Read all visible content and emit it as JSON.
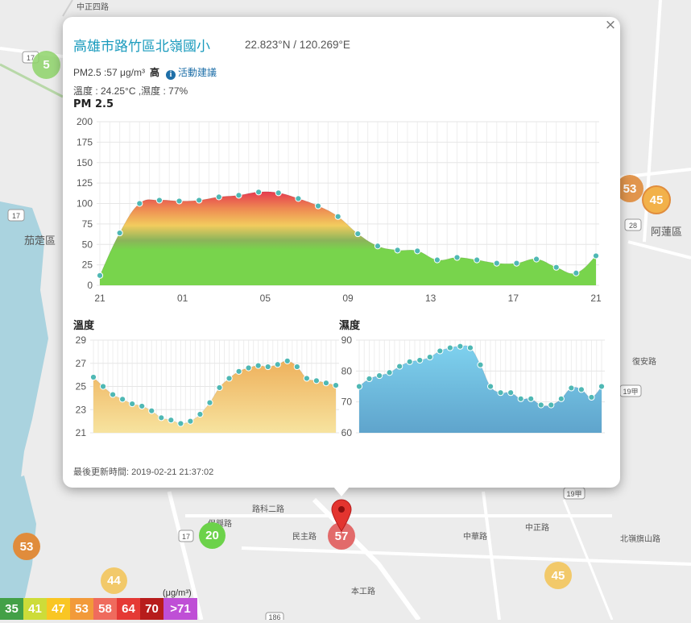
{
  "map": {
    "labels": [
      "中正四路",
      "茄萣區",
      "阿蓮區",
      "民主路",
      "路科二路",
      "中華路",
      "保興路",
      "本工路",
      "中正路",
      "北嶺旗山路",
      "復安路"
    ],
    "route_shields": [
      "17",
      "17",
      "17",
      "28",
      "19甲",
      "19甲",
      "186"
    ],
    "markers": [
      {
        "value": "5",
        "color": "#8fd46a"
      },
      {
        "value": "53",
        "color": "#e08c3c"
      },
      {
        "value": "45",
        "color": "#f2b14a"
      },
      {
        "value": "20",
        "color": "#6cd24a"
      },
      {
        "value": "53",
        "color": "#e08c3c"
      },
      {
        "value": "44",
        "color": "#f2c96a"
      },
      {
        "value": "45",
        "color": "#f2c96a"
      },
      {
        "value": "57",
        "color": "#e26a6a"
      }
    ]
  },
  "popup": {
    "close_label": "×",
    "title": "高雄市路竹區北嶺國小",
    "coords": "22.823°N / 120.269°E",
    "pm25_text": "PM2.5 :57 μg/m³",
    "level": "高",
    "advice_label": "活動建議",
    "info_icon": "i",
    "weather_text": "溫度 : 24.25°C ,濕度 : 77%",
    "pm_section_title": "PM 2.5",
    "temp_section_title": "溫度",
    "humidity_section_title": "濕度",
    "updated": "最後更新時間: 2019-02-21 21:37:02"
  },
  "legend": {
    "unit": "(μg/m³)",
    "items": [
      {
        "label": "35",
        "color": "#43a047"
      },
      {
        "label": "41",
        "color": "#cddc39"
      },
      {
        "label": "47",
        "color": "#f9c623"
      },
      {
        "label": "53",
        "color": "#f29a3a"
      },
      {
        "label": "58",
        "color": "#ef6b5d"
      },
      {
        "label": "64",
        "color": "#e53935"
      },
      {
        "label": "70",
        "color": "#b71c1c"
      },
      {
        "label": ">71",
        "color": "#bf4fd6"
      }
    ]
  },
  "chart_data": [
    {
      "type": "area",
      "title": "PM 2.5",
      "x_tick_labels": [
        "21",
        "01",
        "05",
        "09",
        "13",
        "17",
        "21"
      ],
      "ylim": [
        0,
        200
      ],
      "y_ticks": [
        0,
        25,
        50,
        75,
        100,
        125,
        150,
        175,
        200
      ],
      "grid": true,
      "values": [
        12,
        64,
        100,
        104,
        103,
        104,
        108,
        110,
        114,
        113,
        106,
        97,
        84,
        63,
        48,
        43,
        42,
        31,
        34,
        31,
        27,
        27,
        32,
        22,
        15,
        36
      ]
    },
    {
      "type": "area",
      "title": "溫度",
      "ylim": [
        21,
        29
      ],
      "y_ticks": [
        21,
        23,
        25,
        27,
        29
      ],
      "grid": true,
      "values": [
        25.8,
        25.0,
        24.3,
        23.9,
        23.5,
        23.3,
        22.9,
        22.3,
        22.1,
        21.8,
        22.0,
        22.6,
        23.6,
        24.9,
        25.7,
        26.3,
        26.6,
        26.8,
        26.7,
        26.9,
        27.2,
        26.7,
        25.7,
        25.5,
        25.3,
        25.1
      ]
    },
    {
      "type": "area",
      "title": "濕度",
      "ylim": [
        60,
        90
      ],
      "y_ticks": [
        60,
        70,
        80,
        90
      ],
      "grid": true,
      "values": [
        75,
        77.5,
        78.5,
        79.5,
        81.5,
        83,
        83.5,
        84.5,
        86.5,
        87.5,
        88,
        87.5,
        82,
        75,
        73,
        73,
        71,
        71,
        69,
        69,
        71,
        74.5,
        74,
        71.5,
        75
      ]
    }
  ]
}
